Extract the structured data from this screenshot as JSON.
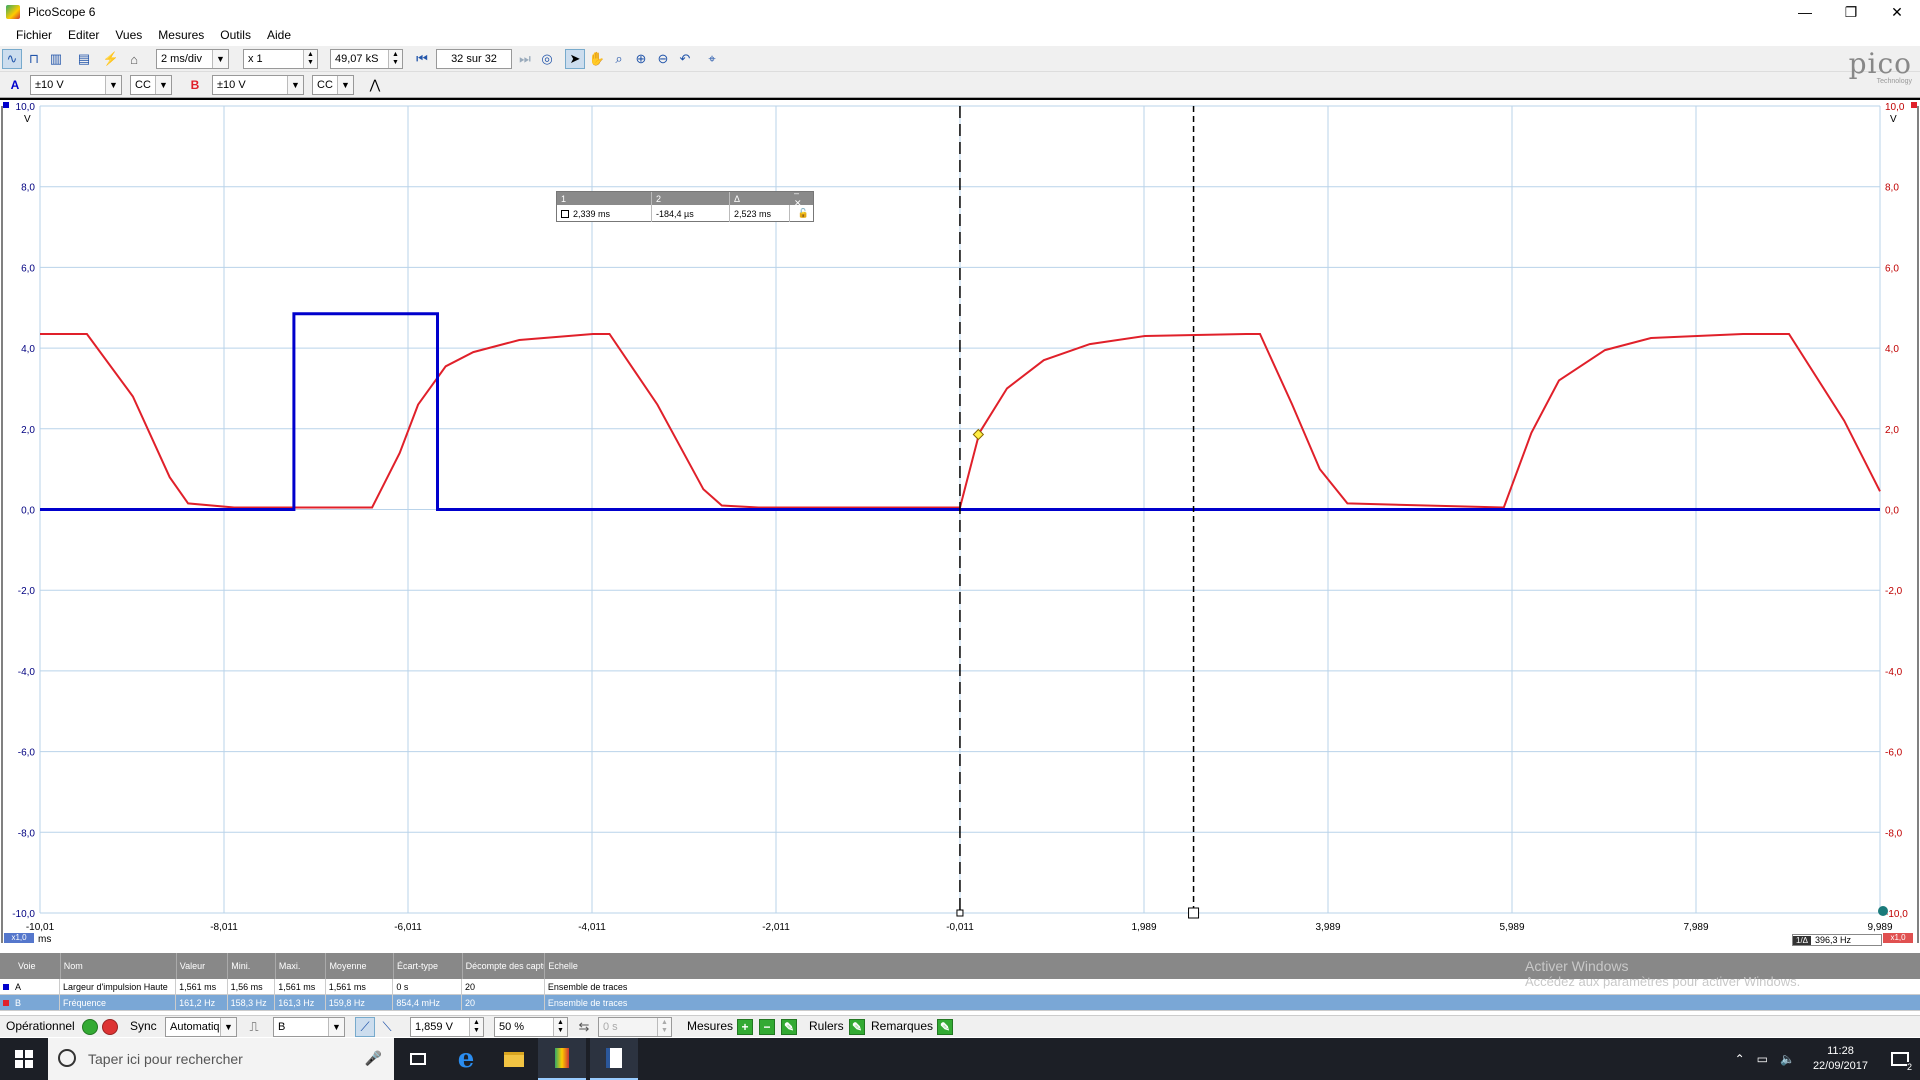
{
  "window": {
    "title": "PicoScope 6",
    "minimize": "—",
    "restore": "❐",
    "close": "✕"
  },
  "menu": {
    "items": [
      "Fichier",
      "Editer",
      "Vues",
      "Mesures",
      "Outils",
      "Aide"
    ]
  },
  "toolbar": {
    "timebase": "2 ms/div",
    "zoom": "x 1",
    "samples": "49,07 kS",
    "capture_nav": "32 sur 32",
    "icons": [
      "scope-mode-icon",
      "persistence-mode-icon",
      "spectrum-mode-icon",
      "spectrum-alt-icon",
      "auto-setup-icon",
      "home-icon",
      "first-capture-icon",
      "next-capture-icon",
      "compass-icon",
      "pointer-icon",
      "hand-icon",
      "zoom-icon",
      "zoom-in-icon",
      "zoom-out-icon",
      "undo-zoom-icon",
      "zoom-fit-icon"
    ]
  },
  "channels": {
    "a": {
      "label": "A",
      "range": "±10 V",
      "coupling": "CC",
      "color": "#0000cc"
    },
    "b": {
      "label": "B",
      "range": "±10 V",
      "coupling": "CC",
      "color": "#e0202a"
    }
  },
  "logo": {
    "word": "pico",
    "sub": "Technology"
  },
  "scope": {
    "left_axis_unit": "V",
    "right_axis_unit": "V",
    "y_ticks_left": [
      "10,0",
      "8,0",
      "6,0",
      "4,0",
      "2,0",
      "0,0",
      "-2,0",
      "-4,0",
      "-6,0",
      "-8,0",
      "-10,0"
    ],
    "y_ticks_right": [
      "10,0",
      "8,0",
      "6,0",
      "4,0",
      "2,0",
      "0,0",
      "-2,0",
      "-4,0",
      "-6,0",
      "-8,0",
      "-10,0"
    ],
    "x_ticks": [
      "-10,01",
      "-8,011",
      "-6,011",
      "-4,011",
      "-2,011",
      "-0,011",
      "1,989",
      "3,989",
      "5,989",
      "7,989",
      "9,989"
    ],
    "x_unit": "ms",
    "x_scale_badge": "x1,0",
    "right_scale_badge": "x1,0",
    "freq_readout": "396,3 Hz",
    "freq_badge": "1/Δ",
    "ruler_1_ms": -0.011,
    "ruler_2_ms": 2.528,
    "trigger_point": {
      "t_ms": 0.189,
      "v": 1.859
    }
  },
  "chart_data": {
    "type": "line",
    "title": "",
    "xlabel": "ms",
    "ylabel": "V",
    "xlim": [
      -10.01,
      9.989
    ],
    "ylim": [
      -10,
      10
    ],
    "grid": true,
    "series": [
      {
        "name": "A",
        "color": "#0000cc",
        "x": [
          -10.01,
          -7.25,
          -7.25,
          -5.69,
          -5.69,
          9.989
        ],
        "y": [
          0.0,
          0.0,
          4.85,
          4.85,
          0.0,
          0.0
        ]
      },
      {
        "name": "B",
        "color": "#e0202a",
        "x": [
          -10.01,
          -9.5,
          -9.0,
          -8.6,
          -8.4,
          -7.9,
          -7.25,
          -6.4,
          -6.1,
          -5.9,
          -5.6,
          -5.3,
          -4.8,
          -4.0,
          -3.82,
          -3.3,
          -2.8,
          -2.6,
          -2.2,
          -0.011,
          0.2,
          0.5,
          0.9,
          1.4,
          2.0,
          3.1,
          3.25,
          3.6,
          3.9,
          4.2,
          5.9,
          6.2,
          6.5,
          7.0,
          7.5,
          8.5,
          9.0,
          9.6,
          9.989
        ],
        "y": [
          4.35,
          4.35,
          2.8,
          0.8,
          0.15,
          0.05,
          0.05,
          0.05,
          1.4,
          2.6,
          3.55,
          3.9,
          4.2,
          4.35,
          4.35,
          2.6,
          0.5,
          0.1,
          0.05,
          0.05,
          1.9,
          3.0,
          3.7,
          4.1,
          4.3,
          4.35,
          4.35,
          2.6,
          1.0,
          0.15,
          0.05,
          1.9,
          3.2,
          3.95,
          4.25,
          4.35,
          4.35,
          2.2,
          0.45
        ]
      }
    ]
  },
  "measure_tooltip": {
    "headers": [
      "1",
      "2",
      "Δ"
    ],
    "values": [
      "2,339 ms",
      "-184,4 µs",
      "2,523 ms"
    ]
  },
  "measurements": {
    "headers": [
      "Voie",
      "Nom",
      "Valeur",
      "Mini.",
      "Maxi.",
      "Moyenne",
      "Écart-type",
      "Décompte des captures",
      "Echelle"
    ],
    "rows": [
      [
        "A",
        "Largeur d'impulsion Haute",
        "1,561 ms",
        "1,56 ms",
        "1,561 ms",
        "1,561 ms",
        "0 s",
        "20",
        "Ensemble de traces"
      ],
      [
        "B",
        "Fréquence",
        "161,2 Hz",
        "158,3 Hz",
        "161,3 Hz",
        "159,8 Hz",
        "854,4 mHz",
        "20",
        "Ensemble de traces"
      ]
    ]
  },
  "bottom": {
    "status": "Opérationnel",
    "sync_label": "Sync",
    "sync_mode": "Automatiq",
    "trigger_channel": "B",
    "trigger_level": "1,859 V",
    "pretrigger": "50 %",
    "delay": "0 s",
    "measures_label": "Mesures",
    "rulers_label": "Rulers",
    "notes_label": "Remarques"
  },
  "watermark": {
    "line1": "Activer Windows",
    "line2": "Accédez aux paramètres pour activer Windows."
  },
  "taskbar": {
    "search_placeholder": "Taper ici pour rechercher",
    "time": "11:28",
    "date": "22/09/2017",
    "notif_count": "2"
  }
}
